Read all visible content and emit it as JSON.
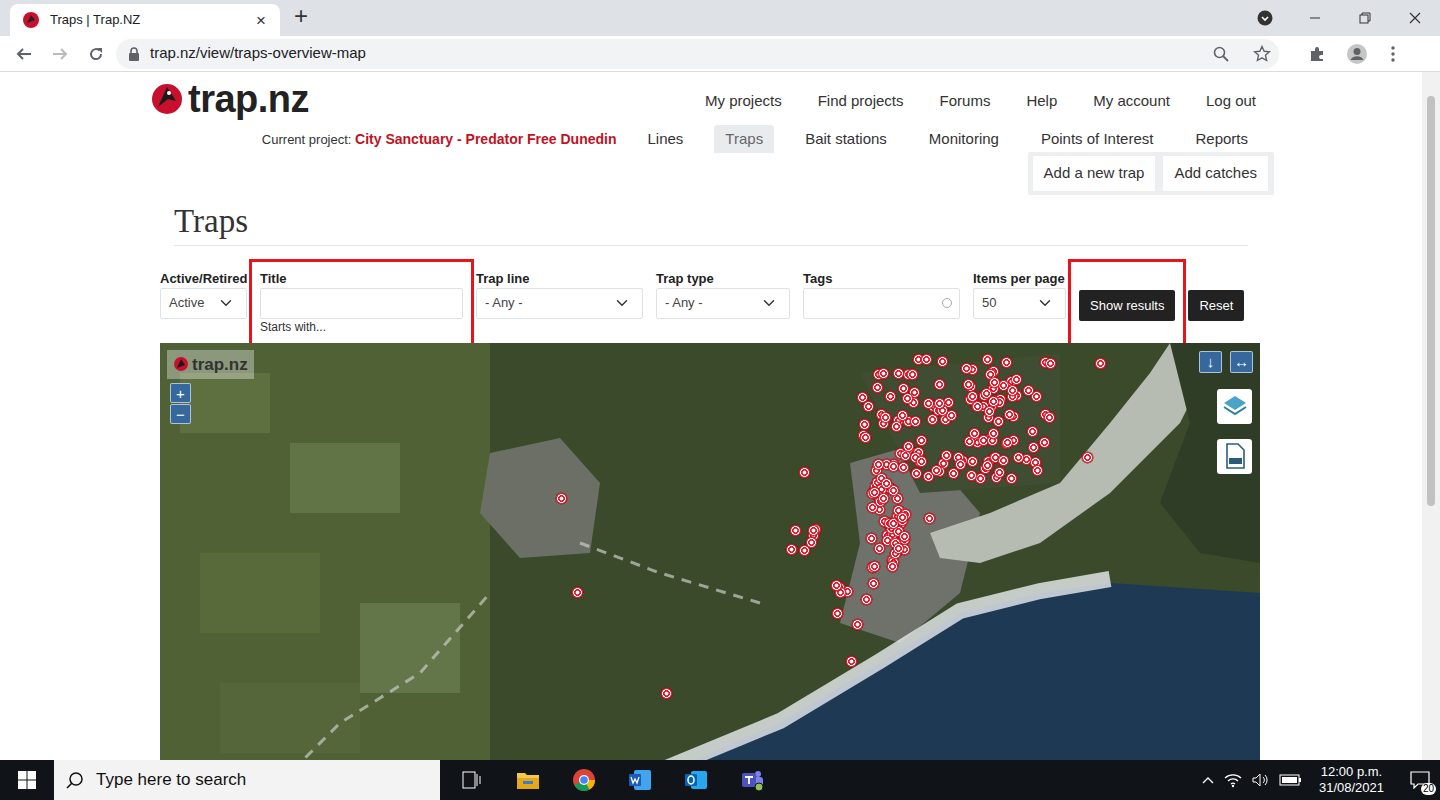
{
  "browser": {
    "tab": {
      "title": "Traps | Trap.NZ",
      "close": "×",
      "selected": true
    },
    "new_tab": "+",
    "url": "trap.nz/view/traps-overview-map"
  },
  "site": {
    "logo": "trap.nz",
    "nav": [
      "My projects",
      "Find projects",
      "Forums",
      "Help",
      "My account",
      "Log out"
    ],
    "current_project_label": "Current project:",
    "current_project": "City Sanctuary - Predator Free Dunedin",
    "sections": [
      {
        "label": "Lines",
        "selected": false
      },
      {
        "label": "Traps",
        "selected": true
      },
      {
        "label": "Bait stations",
        "selected": false
      },
      {
        "label": "Monitoring",
        "selected": false
      },
      {
        "label": "Points of Interest",
        "selected": false
      },
      {
        "label": "Reports",
        "selected": false
      }
    ],
    "actions": [
      "Add a new trap",
      "Add catches"
    ]
  },
  "page": {
    "title": "Traps"
  },
  "filters": {
    "status": {
      "label": "Active/Retired",
      "value": "Active"
    },
    "title": {
      "label": "Title",
      "value": "",
      "help": "Starts with...",
      "highlighted": true
    },
    "trap_line": {
      "label": "Trap line",
      "value": "- Any -"
    },
    "trap_type": {
      "label": "Trap type",
      "value": "- Any -"
    },
    "tags": {
      "label": "Tags",
      "value": ""
    },
    "items_per_page": {
      "label": "Items per page",
      "value": "50"
    },
    "show_results": {
      "label": "Show results",
      "highlighted": true
    },
    "reset": {
      "label": "Reset"
    }
  },
  "map": {
    "watermark": "trap.nz",
    "zoom_in": "+",
    "zoom_out": "−",
    "controls": [
      "↓",
      "↔"
    ]
  },
  "taskbar": {
    "search_placeholder": "Type here to search",
    "time": "12:00 p.m.",
    "date": "31/08/2021",
    "notifications": "20"
  }
}
